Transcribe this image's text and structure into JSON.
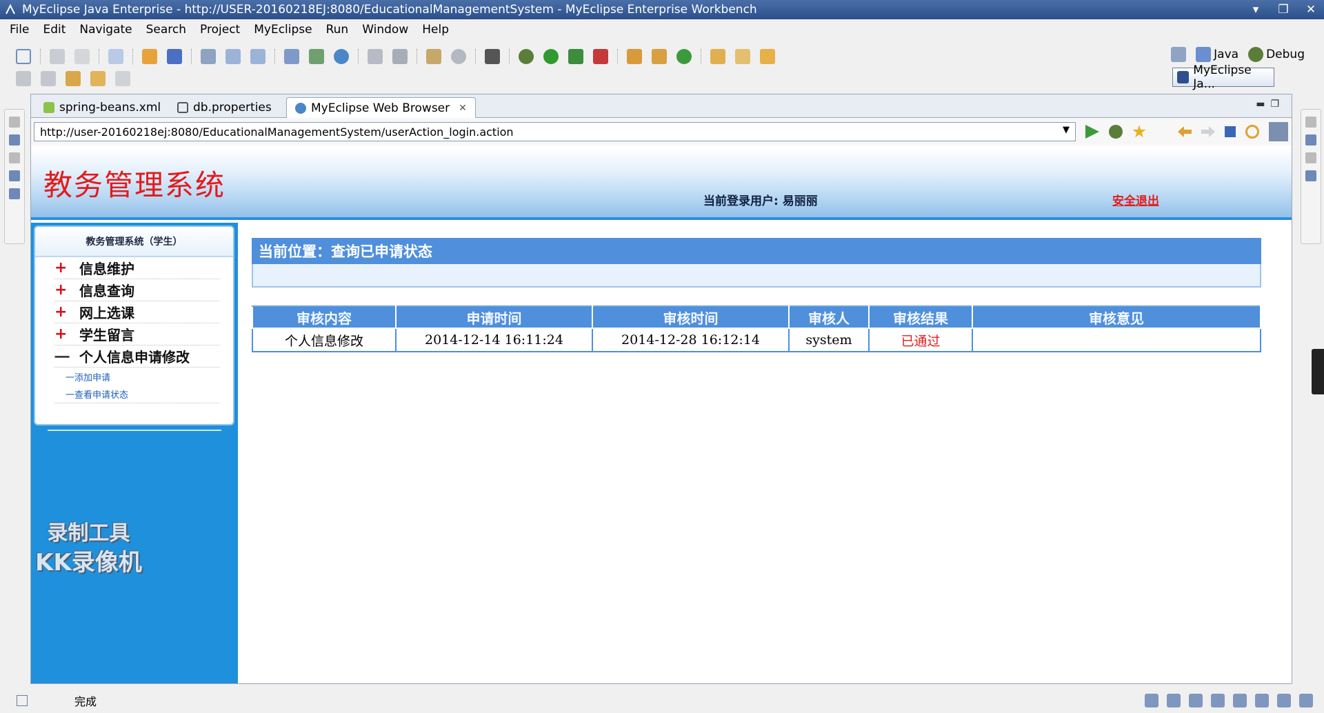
{
  "window": {
    "title": "MyEclipse Java Enterprise - http://USER-20160218EJ:8080/EducationalManagementSystem - MyEclipse Enterprise Workbench"
  },
  "menu": [
    "File",
    "Edit",
    "Navigate",
    "Search",
    "Project",
    "MyEclipse",
    "Run",
    "Window",
    "Help"
  ],
  "perspectives": {
    "java": "Java",
    "debug": "Debug",
    "active": "MyEclipse Ja..."
  },
  "tabs": [
    {
      "label": "spring-beans.xml"
    },
    {
      "label": "db.properties"
    },
    {
      "label": "MyEclipse Web Browser"
    }
  ],
  "browser": {
    "url": "http://user-20160218ej:8080/EducationalManagementSystem/userAction_login.action"
  },
  "page": {
    "logo": "教务管理系统",
    "current_user": "当前登录用户: 易丽丽",
    "logout": "安全退出",
    "sidebar": {
      "heading": "教务管理系统（学生）",
      "items": [
        {
          "sign": "+",
          "label": "信息维护"
        },
        {
          "sign": "+",
          "label": "信息查询"
        },
        {
          "sign": "+",
          "label": "网上选课"
        },
        {
          "sign": "+",
          "label": "学生留言"
        },
        {
          "sign": "一",
          "label": "个人信息申请修改"
        }
      ],
      "subitems": [
        "一添加申请",
        "一查看申请状态"
      ]
    },
    "location": "当前位置：查询已申请状态",
    "table": {
      "headers": [
        "审核内容",
        "申请时间",
        "审核时间",
        "审核人",
        "审核结果",
        "审核意见"
      ],
      "rows": [
        [
          "个人信息修改",
          "2014-12-14 16:11:24",
          "2014-12-28 16:12:14",
          "system",
          "已通过",
          ""
        ]
      ]
    },
    "watermark": {
      "line1": "录制工具",
      "line2": "KK录像机"
    }
  },
  "status": {
    "text": "完成"
  }
}
